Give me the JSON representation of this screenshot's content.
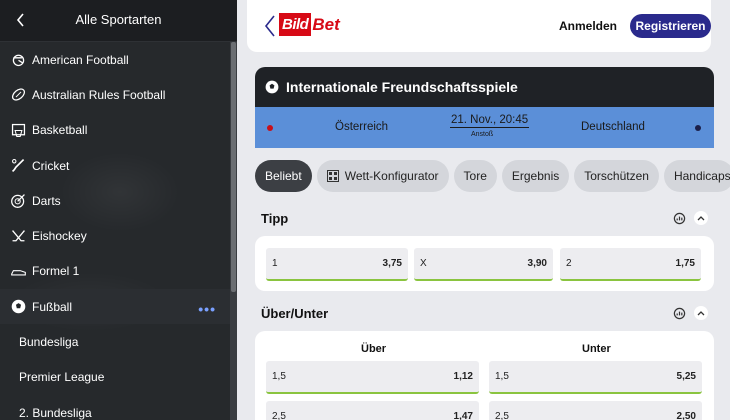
{
  "sidebar": {
    "title": "Alle Sportarten",
    "more_label": "•••",
    "items": [
      {
        "label": "American Football",
        "icon": "american-football-icon"
      },
      {
        "label": "Australian Rules Football",
        "icon": "rugby-ball-icon"
      },
      {
        "label": "Basketball",
        "icon": "basketball-hoop-icon"
      },
      {
        "label": "Cricket",
        "icon": "cricket-bat-icon"
      },
      {
        "label": "Darts",
        "icon": "dartboard-icon"
      },
      {
        "label": "Eishockey",
        "icon": "hockey-sticks-icon"
      },
      {
        "label": "Formel 1",
        "icon": "race-car-icon"
      },
      {
        "label": "Fußball",
        "icon": "soccer-ball-icon"
      }
    ],
    "sub_items": [
      "Bundesliga",
      "Premier League",
      "2. Bundesliga"
    ]
  },
  "header": {
    "logo_left": "Bild",
    "logo_right": "Bet",
    "login_label": "Anmelden",
    "register_label": "Registrieren"
  },
  "event": {
    "competition": "Internationale Freundschaftsspiele",
    "home": "Österreich",
    "away": "Deutschland",
    "datetime": "21. Nov., 20:45",
    "kickoff_label": "Anstoß",
    "colors": {
      "home": "#c8101a",
      "away": "#1b1f4a",
      "bar": "#5b8fd8"
    }
  },
  "tabs": [
    "Beliebt",
    "Wett-Konfigurator",
    "Tore",
    "Ergebnis",
    "Torschützen",
    "Handicaps"
  ],
  "markets": {
    "tipp": {
      "title": "Tipp",
      "odds": [
        {
          "label": "1",
          "value": "3,75"
        },
        {
          "label": "X",
          "value": "3,90"
        },
        {
          "label": "2",
          "value": "1,75"
        }
      ]
    },
    "over_under": {
      "title": "Über/Unter",
      "col_over": "Über",
      "col_under": "Unter",
      "rows": [
        {
          "over_label": "1,5",
          "over_value": "1,12",
          "under_label": "1,5",
          "under_value": "5,25"
        },
        {
          "over_label": "2,5",
          "over_value": "1,47",
          "under_label": "2,5",
          "under_value": "2,50"
        }
      ]
    }
  }
}
